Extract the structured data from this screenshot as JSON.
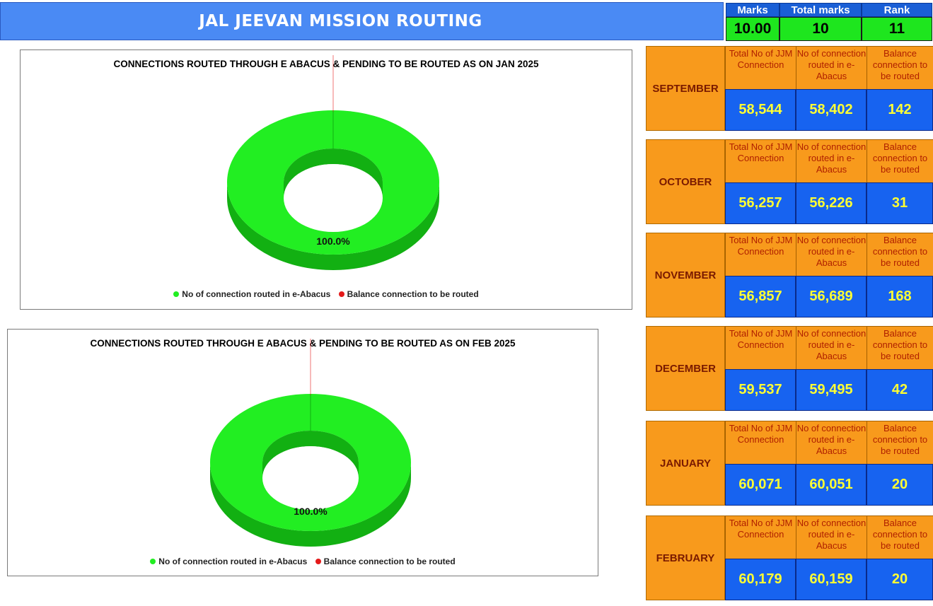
{
  "header": {
    "title": "JAL JEEVAN MISSION ROUTING"
  },
  "score": {
    "headers": [
      "Marks",
      "Total marks",
      "Rank"
    ],
    "values": [
      "10.00",
      "10",
      "11"
    ]
  },
  "colors": {
    "routed": "#22ee22",
    "routed_side": "#12b012",
    "balance": "#e41a1a"
  },
  "labels": {
    "total": "Total No of JJM Connection",
    "routed": "No of connection routed in e-Abacus",
    "balance": "Balance connection to be routed"
  },
  "months": [
    {
      "name": "SEPTEMBER",
      "total": "58,544",
      "routed": "58,402",
      "balance": "142"
    },
    {
      "name": "OCTOBER",
      "total": "56,257",
      "routed": "56,226",
      "balance": "31"
    },
    {
      "name": "NOVEMBER",
      "total": "56,857",
      "routed": "56,689",
      "balance": "168"
    },
    {
      "name": "DECEMBER",
      "total": "59,537",
      "routed": "59,495",
      "balance": "42"
    },
    {
      "name": "JANUARY",
      "total": "60,071",
      "routed": "60,051",
      "balance": "20"
    },
    {
      "name": "FEBRUARY",
      "total": "60,179",
      "routed": "60,159",
      "balance": "20"
    }
  ],
  "chart_data": [
    {
      "type": "pie",
      "title": "CONNECTIONS ROUTED THROUGH E ABACUS & PENDING TO BE ROUTED AS ON  JAN 2025",
      "categories": [
        "No of connection routed in e-Abacus",
        "Balance connection to be routed"
      ],
      "values": [
        60051,
        20
      ],
      "data_labels": [
        "100.0%",
        ""
      ],
      "legend": "bottom"
    },
    {
      "type": "pie",
      "title": "CONNECTIONS ROUTED THROUGH E ABACUS & PENDING TO BE ROUTED AS ON  FEB  2025",
      "categories": [
        "No of connection routed in e-Abacus",
        "Balance connection to be routed"
      ],
      "values": [
        60159,
        20
      ],
      "data_labels": [
        "100.0%",
        ""
      ],
      "legend": "bottom"
    }
  ]
}
